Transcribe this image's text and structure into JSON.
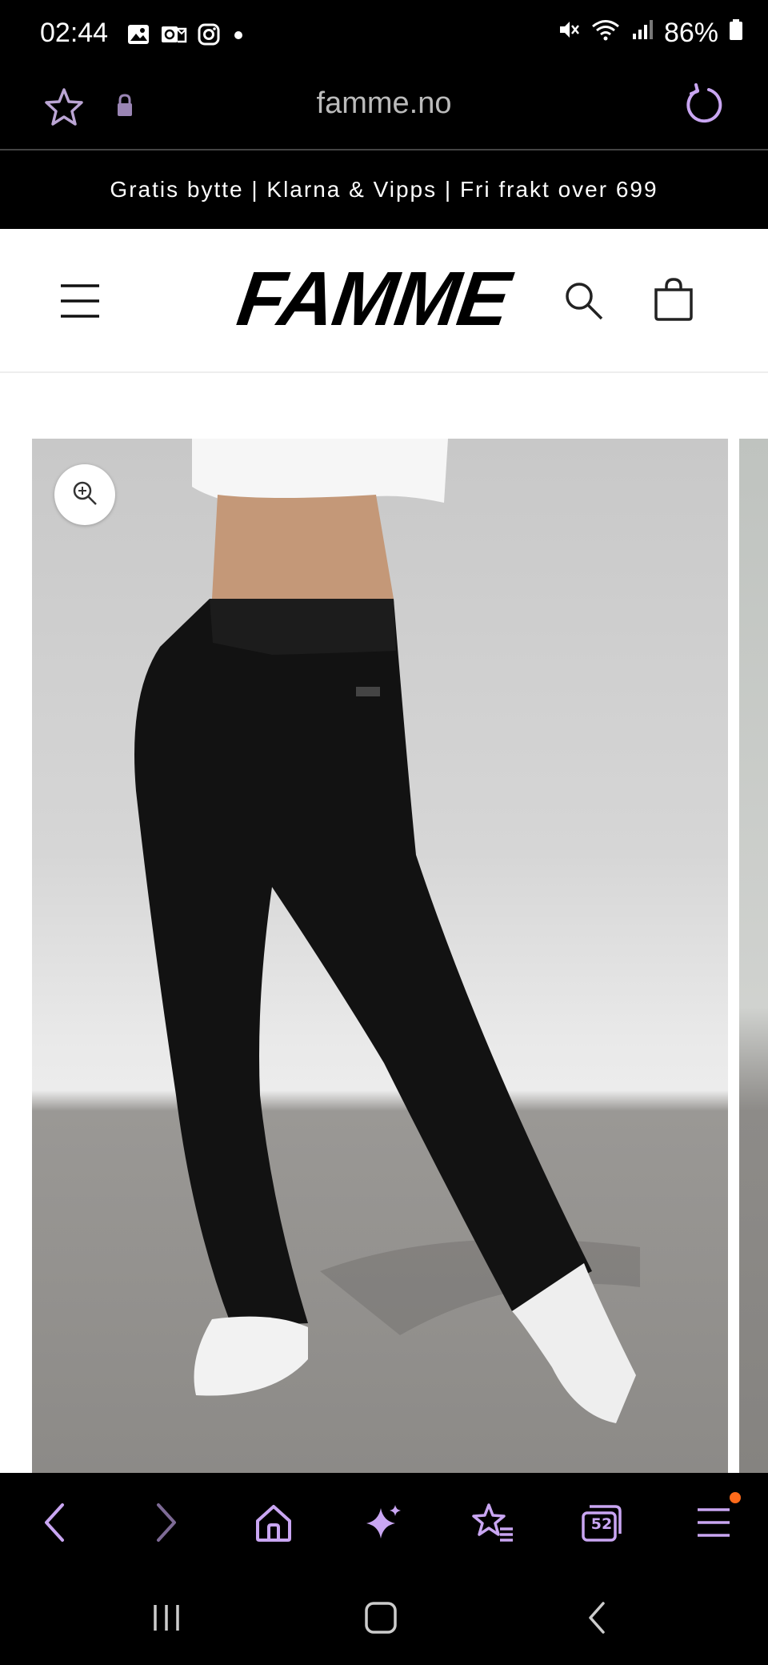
{
  "status_bar": {
    "time": "02:44",
    "battery": "86%"
  },
  "browser": {
    "url": "famme.no",
    "tab_count": "52",
    "accent_color": "#c9a6f2"
  },
  "site": {
    "promo_text": "Gratis bytte | Klarna & Vipps | Fri frakt over 699",
    "logo": "FAMME"
  },
  "icons": {
    "status_left": [
      "gallery-icon",
      "outlook-icon",
      "instagram-icon",
      "notification-dot-icon"
    ],
    "status_right": [
      "mute-icon",
      "wifi-icon",
      "signal-icon",
      "battery-icon"
    ],
    "url_bar": [
      "bookmark-star-icon",
      "lock-icon",
      "reload-icon"
    ],
    "site_header": [
      "menu-icon",
      "search-icon",
      "cart-icon"
    ],
    "product": [
      "zoom-icon"
    ],
    "browser_nav": [
      "back-icon",
      "forward-icon",
      "home-icon",
      "ai-sparkle-icon",
      "bookmarks-icon",
      "tabs-icon",
      "menu-icon"
    ],
    "system_nav": [
      "recents-icon",
      "home-icon",
      "back-icon"
    ]
  }
}
